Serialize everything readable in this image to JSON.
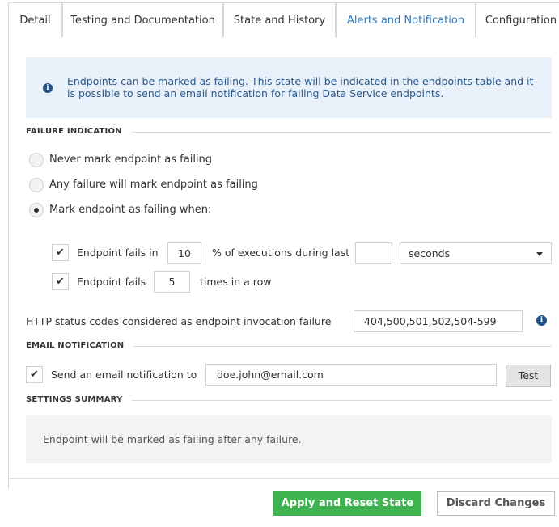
{
  "tabs": [
    {
      "label": "Detail",
      "active": false
    },
    {
      "label": "Testing and Documentation",
      "active": false
    },
    {
      "label": "State and History",
      "active": false
    },
    {
      "label": "Alerts and Notification",
      "active": true
    },
    {
      "label": "Configuration",
      "active": false
    }
  ],
  "info": {
    "icon": "info-icon",
    "text": "Endpoints can be marked as failing. This state will be indicated in the endpoints table and it is possible to send an email notification for failing Data Service endpoints."
  },
  "failure_indication": {
    "title": "FAILURE INDICATION",
    "options": [
      {
        "label": "Never mark endpoint as failing",
        "checked": false
      },
      {
        "label": "Any failure will mark endpoint as failing",
        "checked": false
      },
      {
        "label": "Mark endpoint as failing when:",
        "checked": true
      }
    ],
    "rule1": {
      "checked": true,
      "prefix": "Endpoint fails in",
      "percent_value": "10",
      "middle": "% of executions during last",
      "period_value": "",
      "unit_selected": "seconds"
    },
    "rule2": {
      "checked": true,
      "prefix": "Endpoint fails",
      "count_value": "5",
      "suffix": "times in a row"
    },
    "http_label": "HTTP status codes considered as endpoint invocation failure",
    "http_value": "404,500,501,502,504-599"
  },
  "email_notification": {
    "title": "EMAIL NOTIFICATION",
    "checked": true,
    "label": "Send an email notification to",
    "email_value": "doe.john@email.com",
    "test_label": "Test"
  },
  "settings_summary": {
    "title": "SETTINGS SUMMARY",
    "text": "Endpoint will be marked as failing after any failure."
  },
  "footer": {
    "apply_label": "Apply and Reset State",
    "discard_label": "Discard Changes"
  },
  "colors": {
    "accent": "#2e7cc4",
    "info_bg": "#e8f0fa",
    "apply_bg": "#3fb34f"
  }
}
